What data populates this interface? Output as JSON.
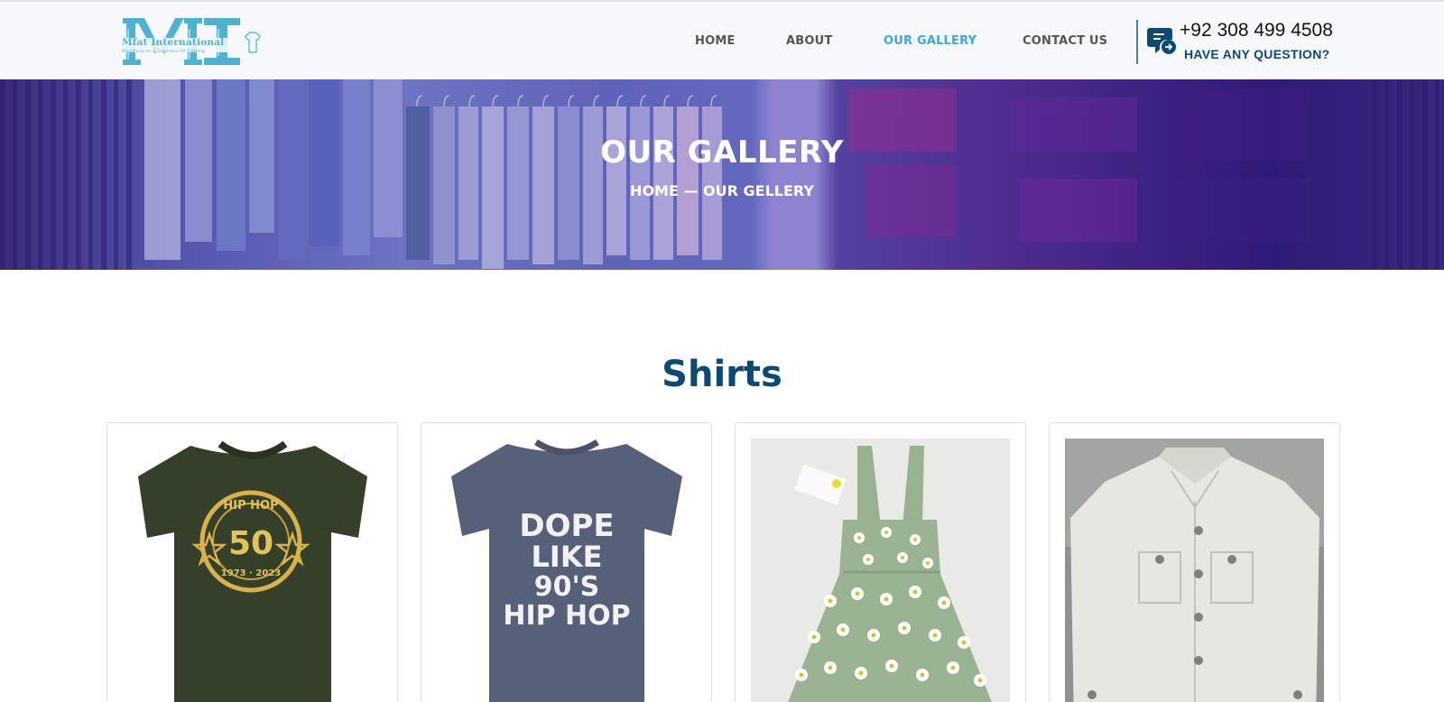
{
  "header": {
    "logo": {
      "wordmark": "Mfat International",
      "tagline": "Manufacturer & Exporters Of Clothing"
    },
    "nav": [
      {
        "label": "HOME",
        "active": false
      },
      {
        "label": "ABOUT",
        "active": false
      },
      {
        "label": "OUR GALLERY",
        "active": true
      },
      {
        "label": "CONTACT US",
        "active": false
      }
    ],
    "contact": {
      "phone": "+92 308 499 4508",
      "question": "HAVE ANY QUESTION?",
      "icon": "chat-arrow-icon"
    }
  },
  "banner": {
    "title": "OUR GALLERY",
    "breadcrumb": "HOME — OUR GELLERY"
  },
  "gallery": {
    "section_title": "Shirts",
    "items": [
      {
        "image": "green-tshirt-hip-hop-50",
        "print_lines": [
          "HIP HOP",
          "50",
          "1973 · 2023"
        ]
      },
      {
        "image": "grey-tshirt-dope-like-90s",
        "print_lines": [
          "DOPE",
          "LIKE",
          "90'S",
          "HIP HOP"
        ]
      },
      {
        "image": "daisy-pinafore-dress"
      },
      {
        "image": "white-denim-jacket"
      }
    ]
  },
  "colors": {
    "accent": "#3ea8d6",
    "brand_dark": "#0d4a73",
    "nav_text": "#555555",
    "logo": "#4eb3d3"
  }
}
